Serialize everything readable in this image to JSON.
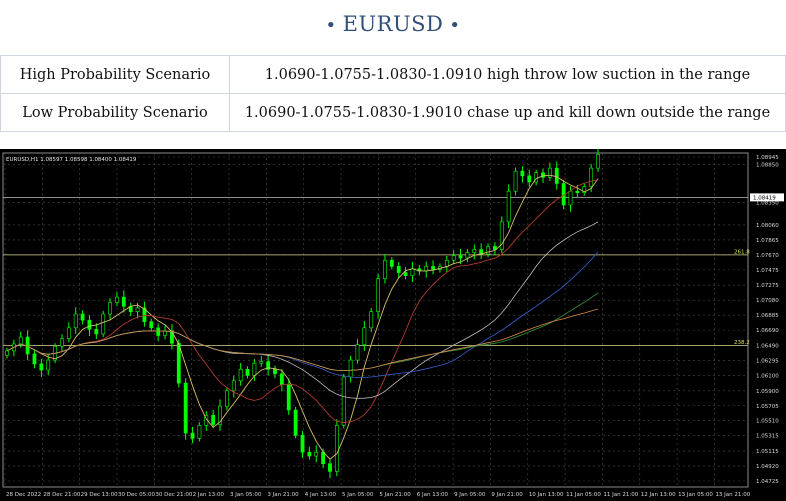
{
  "header": {
    "title": "EURUSD",
    "dot_left": "•",
    "dot_right": "•"
  },
  "scenarios": [
    {
      "label": "High Probability Scenario",
      "value": "1.0690-1.0755-1.0830-1.0910 high throw low suction in the range"
    },
    {
      "label": "Low Probability Scenario",
      "value": "1.0690-1.0755-1.0830-1.9010   chase up and kill down outside the range"
    }
  ],
  "chart_data": {
    "type": "candlestick",
    "symbol_info": "EURUSD,H1  1.08597 1.08598 1.08400 1.08419",
    "current_price_label": "1.08419",
    "price_ticks": [
      "1.08945",
      "1.08850",
      "1.08350",
      "1.08060",
      "1.07865",
      "1.07670",
      "1.07475",
      "1.07275",
      "1.07080",
      "1.06885",
      "1.06690",
      "1.06490",
      "1.06295",
      "1.06100",
      "1.05900",
      "1.05705",
      "1.05510",
      "1.05315",
      "1.05115",
      "1.04920",
      "1.04725"
    ],
    "time_ticks": [
      "28 Dec 2022",
      "28 Dec 21:00",
      "29 Dec 13:00",
      "30 Dec 05:00",
      "30 Dec 21:00",
      "2 Jan 13:00",
      "3 Jan 05:00",
      "3 Jan 21:00",
      "4 Jan 13:00",
      "5 Jan 05:00",
      "5 Jan 21:00",
      "6 Jan 13:00",
      "9 Jan 05:00",
      "9 Jan 21:00",
      "10 Jan 13:00",
      "11 Jan 05:00",
      "11 Jan 21:00",
      "12 Jan 13:00",
      "13 Jan 05:00",
      "13 Jan 21:00"
    ],
    "fib_labels": [
      "261.8",
      "238.2"
    ],
    "close_series": [
      1.0642,
      1.0651,
      1.066,
      1.0638,
      1.0625,
      1.0617,
      1.063,
      1.0648,
      1.0658,
      1.0672,
      1.069,
      1.0682,
      1.067,
      1.0664,
      1.069,
      1.0705,
      1.0712,
      1.07,
      1.0693,
      1.0698,
      1.068,
      1.0672,
      1.0662,
      1.0668,
      1.0652,
      1.06,
      1.0535,
      1.0528,
      1.0545,
      1.0558,
      1.0546,
      1.057,
      1.059,
      1.0603,
      1.0618,
      1.061,
      1.0626,
      1.0628,
      1.0618,
      1.0612,
      1.0598,
      1.0565,
      1.0532,
      1.051,
      1.0505,
      1.051,
      1.0495,
      1.0485,
      1.0545,
      1.0608,
      1.063,
      1.065,
      1.0672,
      1.0693,
      1.0736,
      1.076,
      1.0752,
      1.0744,
      1.074,
      1.0749,
      1.0746,
      1.0752,
      1.0748,
      1.0752,
      1.076,
      1.0766,
      1.0763,
      1.077,
      1.0774,
      1.0768,
      1.0778,
      1.0774,
      1.081,
      1.085,
      1.0876,
      1.087,
      1.0862,
      1.0874,
      1.0868,
      1.088,
      1.086,
      1.0832,
      1.085,
      1.0848,
      1.0856,
      1.088,
      1.0898
    ],
    "colors": {
      "bull": "#00ff00",
      "bear": "#00ff00",
      "background": "#000000",
      "grid": "#4a4a4a"
    }
  }
}
